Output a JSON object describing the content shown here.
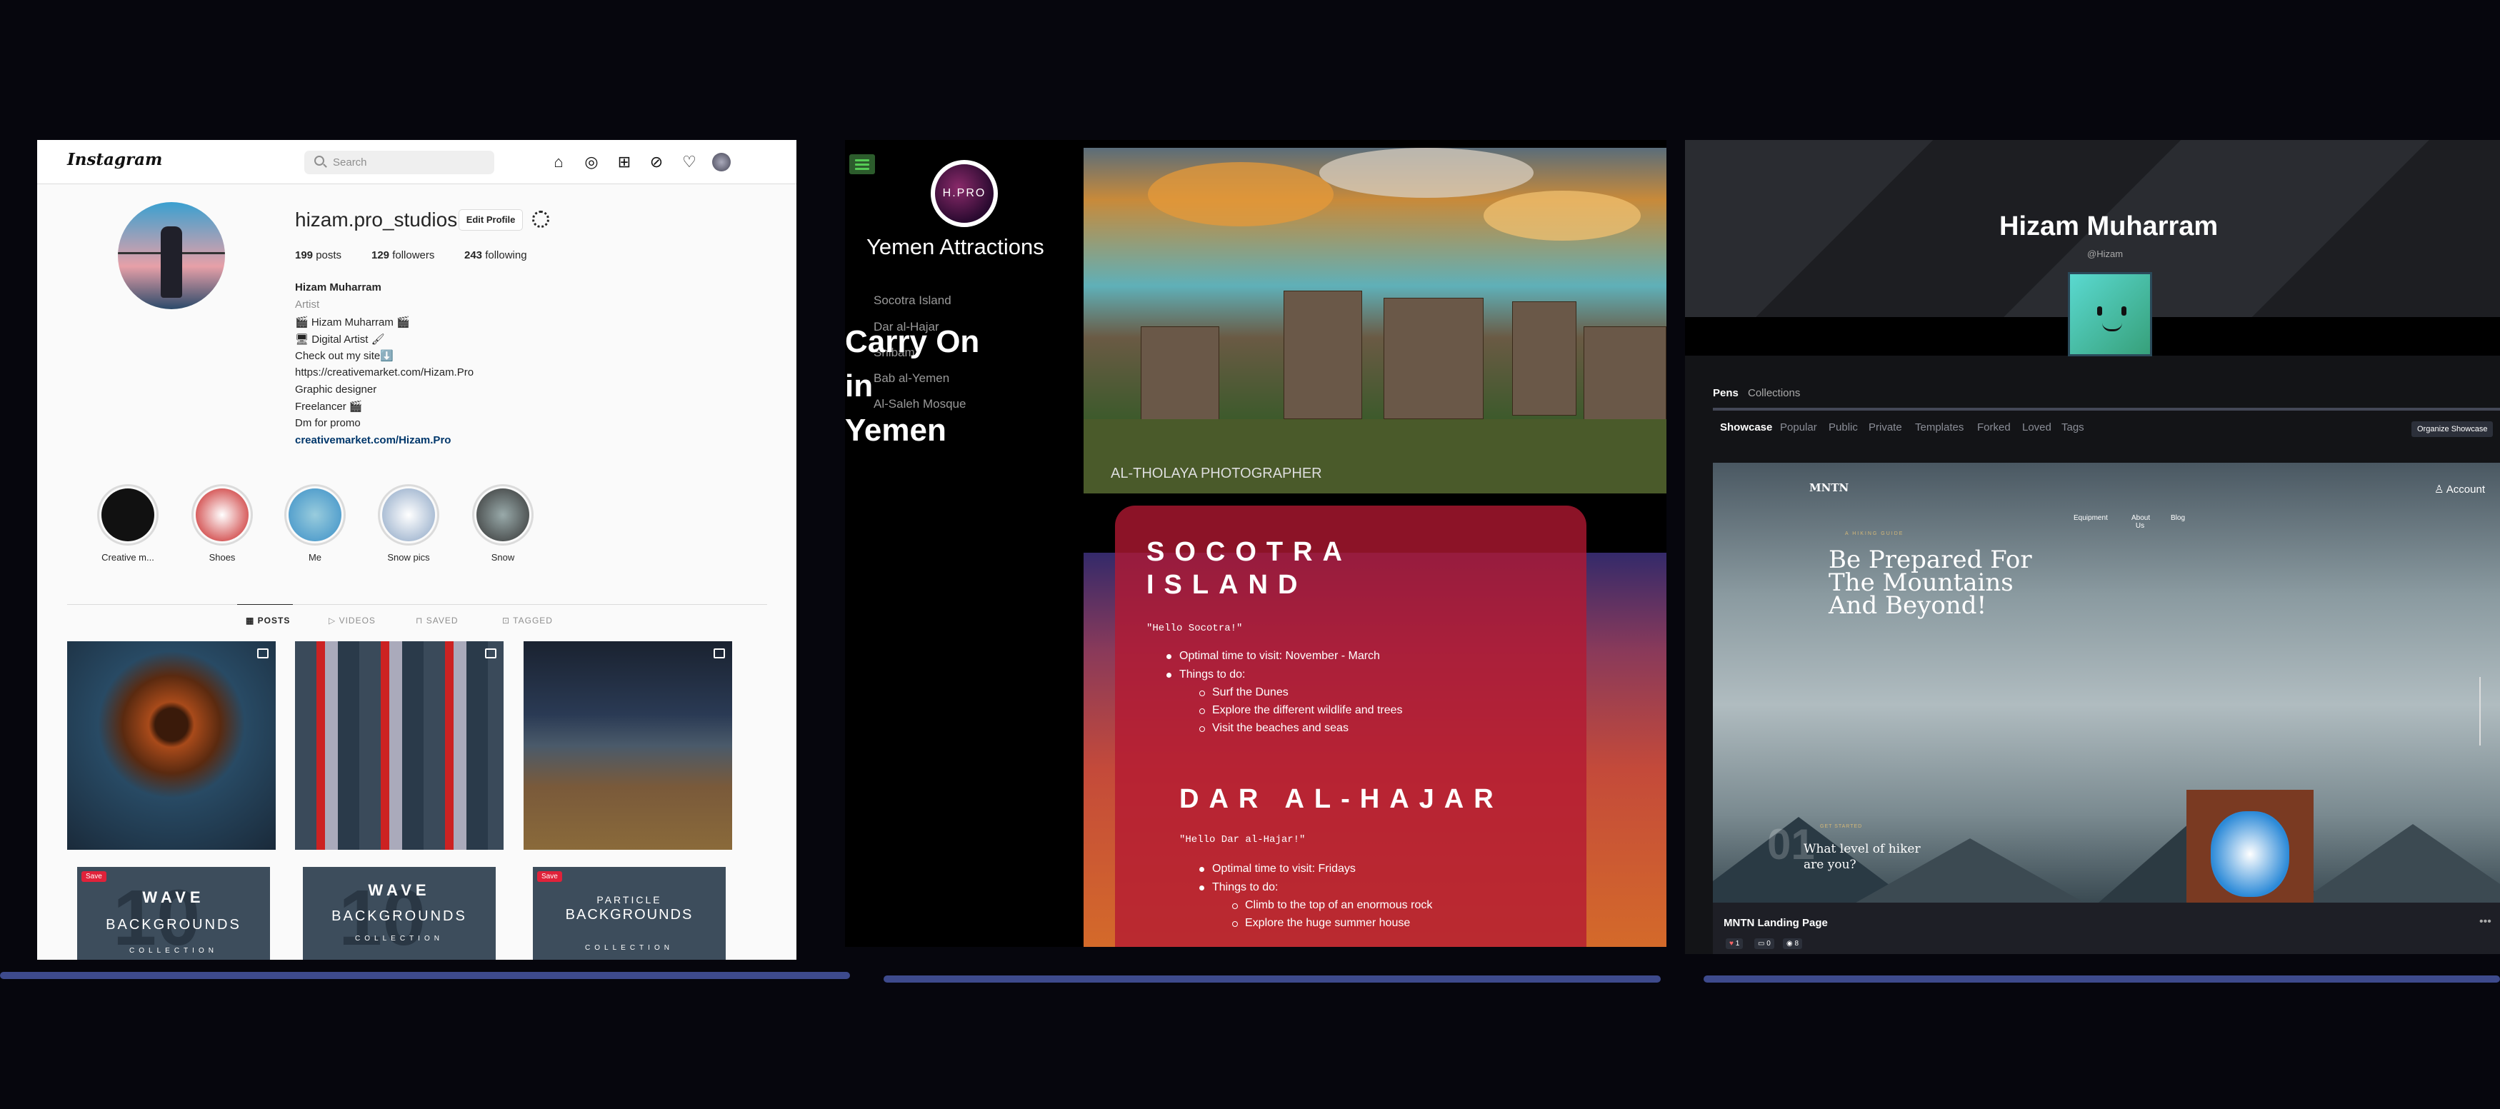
{
  "instagram": {
    "logo": "Instagram",
    "search_placeholder": "Search",
    "username": "hizam.pro_studios",
    "edit_profile": "Edit Profile",
    "stats": [
      {
        "num": "199",
        "label": "posts"
      },
      {
        "num": "129",
        "label": "followers"
      },
      {
        "num": "243",
        "label": "following"
      }
    ],
    "full_name": "Hizam Muharram",
    "category": "Artist",
    "bio_lines": [
      "🎬 Hizam Muharram 🎬",
      "🖥 Digital Artist 🖌",
      "Check out my site⬇️",
      "https://creativemarket.com/Hizam.Pro",
      "Graphic designer",
      "Freelancer 🎬",
      "Dm for promo"
    ],
    "link": "creativemarket.com/Hizam.Pro",
    "highlights": [
      "Creative m...",
      "Shoes",
      "Me",
      "Snow pics",
      "Snow"
    ],
    "tabs": [
      "POSTS",
      "VIDEOS",
      "SAVED",
      "TAGGED"
    ],
    "post_cards": [
      {
        "save": "Save",
        "title": "WAVE",
        "sub": "BACKGROUNDS",
        "num": "10",
        "coll": "COLLECTION"
      },
      {
        "save": "",
        "title": "WAVE",
        "sub": "BACKGROUNDS",
        "num": "10",
        "coll": "COLLECTION"
      },
      {
        "save": "Save",
        "title": "PARTICLE",
        "sub": "BACKGROUNDS",
        "num": "",
        "coll": "COLLECTION"
      }
    ]
  },
  "yemen": {
    "logo": "H.PRO",
    "title": "Yemen Attractions",
    "nav": [
      "Socotra Island",
      "Dar al-Hajar",
      "Shibam",
      "Bab al-Yemen",
      "Al-Saleh Mosque"
    ],
    "hero_lines": [
      "Carry On",
      "in",
      "Yemen"
    ],
    "hero_credit": "AL-THOLAYA PHOTOGRAPHER",
    "socotra": {
      "heading_1": "SOCOTRA",
      "heading_2": "ISLAND",
      "quote": "\"Hello Socotra!\"",
      "items": [
        "Optimal time to visit: November - March",
        "Things to do:"
      ],
      "subitems": [
        "Surf the Dunes",
        "Explore the different wildlife and trees",
        "Visit the beaches and seas"
      ]
    },
    "hajar": {
      "heading": "DAR AL-HAJAR",
      "quote": "\"Hello Dar al-Hajar!\"",
      "items": [
        "Optimal time to visit: Fridays",
        "Things to do:"
      ],
      "subitems": [
        "Climb to the top of an enormous rock",
        "Explore the huge summer house"
      ]
    }
  },
  "codepen": {
    "name": "Hizam Muharram",
    "handle": "@Hizam",
    "tabs_top": [
      "Pens",
      "Collections"
    ],
    "tabs": [
      "Showcase",
      "Popular",
      "Public",
      "Private",
      "Templates",
      "Forked",
      "Loved",
      "Tags"
    ],
    "organize": "Organize Showcase",
    "preview": {
      "brand": "MNTN",
      "account": "Account",
      "nav": [
        "Equipment",
        "About Us",
        "Blog"
      ],
      "eyebrow": "A HIKING GUIDE",
      "headline": [
        "Be Prepared For",
        "The Mountains",
        "And Beyond!"
      ],
      "step_num": "01",
      "step_eyebrow": "GET STARTED",
      "step_title": [
        "What level of hiker",
        "are you?"
      ]
    },
    "pen_title": "MNTN Landing Page",
    "counts": {
      "likes": "1",
      "comments": "0",
      "views": "8"
    }
  }
}
